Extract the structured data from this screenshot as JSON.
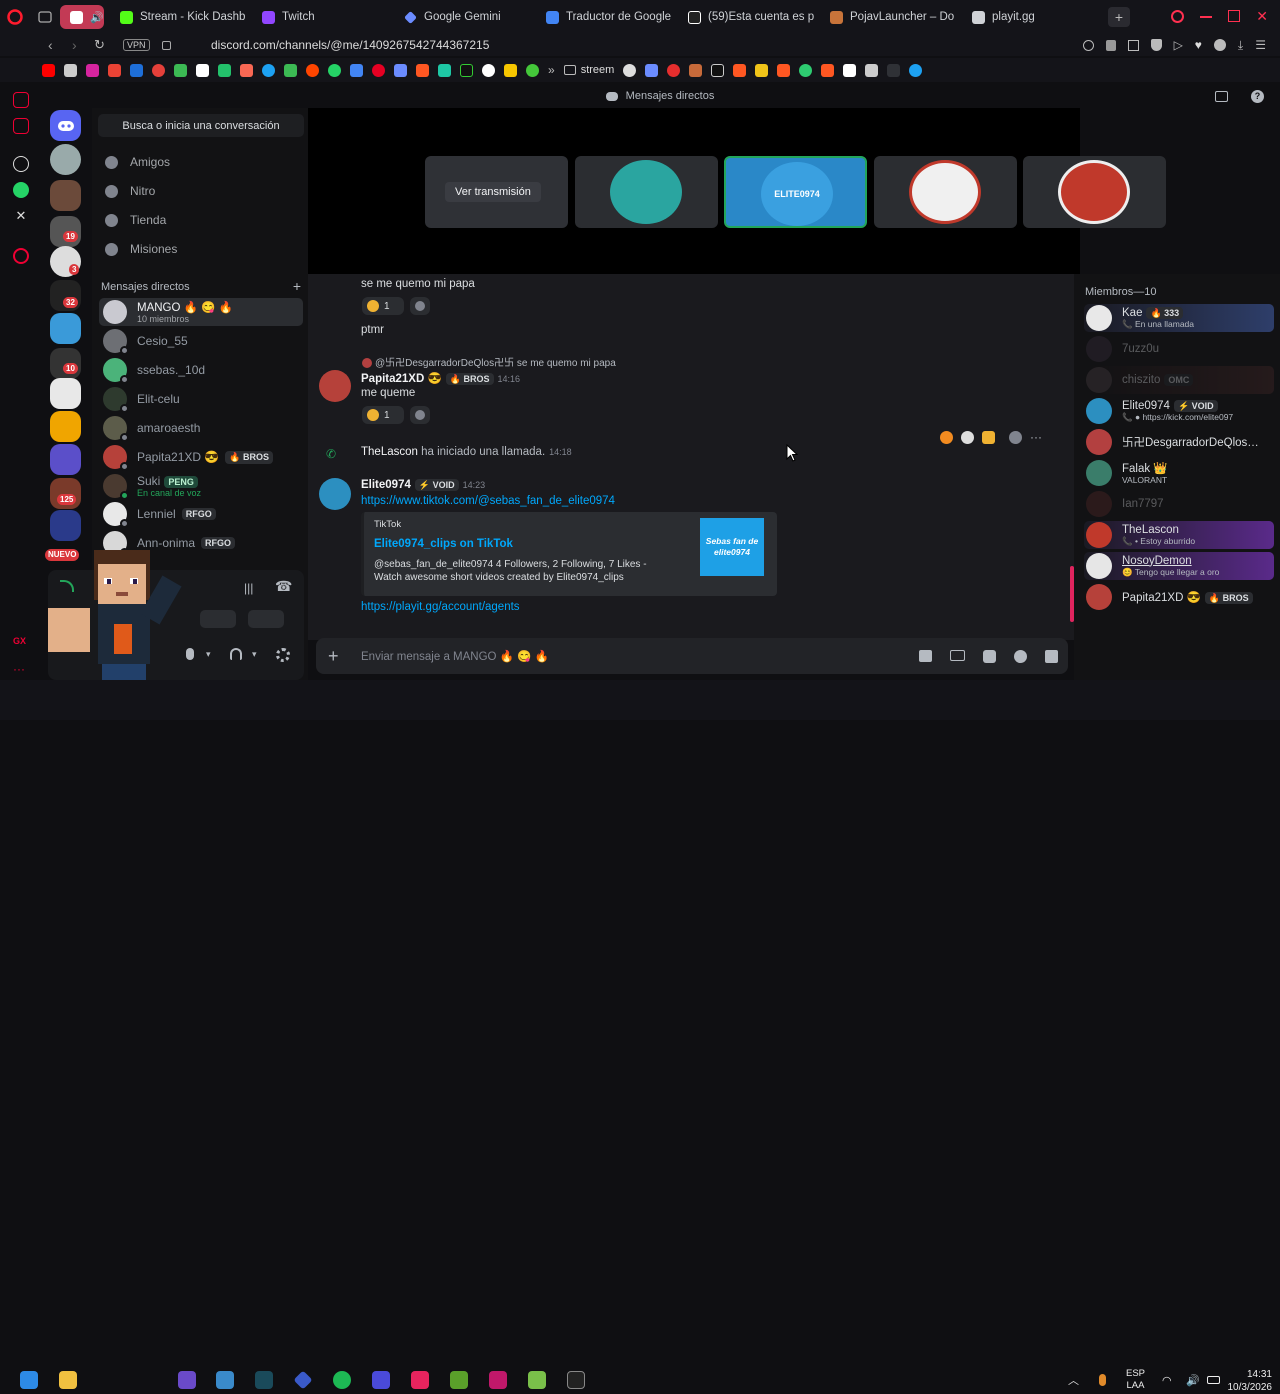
{
  "browser": {
    "tabs": [
      {
        "label": "",
        "icon": "youtube-music-icon",
        "color": "#e74c6b"
      },
      {
        "label": "Stream - Kick Dashb",
        "icon": "kick-icon",
        "color": "#53fc18"
      },
      {
        "label": "Twitch",
        "icon": "twitch-icon",
        "color": "#9146ff"
      },
      {
        "label": "Google Gemini",
        "icon": "gemini-icon",
        "color": "#6b8cff"
      },
      {
        "label": "Traductor de Google",
        "icon": "translate-icon",
        "color": "#4285f4"
      },
      {
        "label": "(59)Esta cuenta es p",
        "icon": "tiktok-icon",
        "color": "#ffffff"
      },
      {
        "label": "PojavLauncher – Do",
        "icon": "box-icon",
        "color": "#c8743a"
      },
      {
        "label": "playit.gg",
        "icon": "playit-icon",
        "color": "#cfd2d6"
      }
    ],
    "vpn": "VPN",
    "url": "discord.com/channels/@me/1409267542744367215",
    "bookmark_folder": "streem"
  },
  "discord": {
    "top_title": "Mensajes directos",
    "search_placeholder": "Busca o inicia una conversación",
    "nav": [
      {
        "label": "Amigos"
      },
      {
        "label": "Nitro"
      },
      {
        "label": "Tienda"
      },
      {
        "label": "Misiones"
      }
    ],
    "dm_header": "Mensajes directos",
    "dm_add": "+",
    "dms": [
      {
        "name": "MANGO 🔥 😋 🔥",
        "sub": "10 miembros",
        "color": "#c9c9d0",
        "selected": true
      },
      {
        "name": "Cesio_55",
        "sub": "",
        "color": "#6d6f74"
      },
      {
        "name": "ssebas._10d",
        "sub": "",
        "color": "#4bb37a"
      },
      {
        "name": "Elit-celu",
        "sub": "",
        "color": "#2e3a2e"
      },
      {
        "name": "amaroaesth",
        "sub": "",
        "color": "#5c5c4a"
      },
      {
        "name": "Papita21XD 😎",
        "tag": "🔥 BROS",
        "sub": "",
        "color": "#b6413a"
      },
      {
        "name": "Suki",
        "tag": "PENG",
        "sub": "En canal de voz",
        "color": "#4a3a30"
      },
      {
        "name": "Lenniel",
        "tag": "RFGO",
        "sub": "",
        "color": "#e8e8e8"
      },
      {
        "name": "Ann-onima",
        "tag": "RFGO",
        "sub": "",
        "color": "#d8d8d8"
      }
    ],
    "server_badges": [
      "19",
      "3",
      "32",
      "10",
      "125"
    ],
    "new_badge": "NUEVO",
    "stream_button": "Ver transmisión",
    "tile_logo_text": "ELITE0974",
    "messages": {
      "m1": "se me quemo mi papa",
      "react1_count": "1",
      "m2": "ptmr",
      "reply_ref": "@卐卍DesgarradorDeQlos卍卐 se me quemo mi papa",
      "author1": "Papita21XD 😎",
      "author1_tag": "🔥 BROS",
      "author1_time": "14:16",
      "m3": "me queme",
      "react2_count": "1",
      "call_user": "TheLascon",
      "call_text": "ha iniciado una llamada.",
      "call_time": "14:18",
      "author2": "Elite0974",
      "author2_tag": "⚡ VOID",
      "author2_time": "14:23",
      "link1": "https://www.tiktok.com/@sebas_fan_de_elite0974",
      "embed_provider": "TikTok",
      "embed_title": "Elite0974_clips on TikTok",
      "embed_desc1": "@sebas_fan_de_elite0974 4 Followers, 2 Following, 7 Likes -",
      "embed_desc2": "Watch awesome short videos created by Elite0974_clips",
      "embed_thumb": "Sebas fan de elite0974",
      "link2": "https://playit.gg/account/agents"
    },
    "composer_placeholder": "Enviar mensaje a MANGO 🔥 😋 🔥",
    "members_header": "Miembros—10",
    "members": [
      {
        "name": "Kae",
        "tag": "🔥 333",
        "status": "📞 En una llamada",
        "color": "#e8e8e8",
        "active": true
      },
      {
        "name": "7uzz0u",
        "status": "",
        "color": "#3a3140",
        "offline": true
      },
      {
        "name": "chiszito",
        "tag": "OMC",
        "status": "",
        "color": "#4b4246",
        "offline": true
      },
      {
        "name": "Elite0974",
        "tag": "⚡ VOID",
        "status": "📞 ● https://kick.com/elite097",
        "color": "#2c8fc0"
      },
      {
        "name": "卐卍DesgarradorDeQlos…",
        "status": "",
        "color": "#b34040"
      },
      {
        "name": "Falak 👑",
        "status": "VALORANT",
        "color": "#3a7d6a"
      },
      {
        "name": "Ian7797",
        "status": "",
        "color": "#5a2a2a",
        "offline": true
      },
      {
        "name": "TheLascon",
        "status": "📞 • Estoy aburrido",
        "color": "#c0392b",
        "active": true
      },
      {
        "name": "NosoyDemon",
        "status": "😊 Tengo que llegar a oro",
        "color": "#e6e6e6",
        "active": true
      },
      {
        "name": "Papita21XD 😎",
        "tag": "🔥 BROS",
        "status": "",
        "color": "#b6413a"
      }
    ]
  },
  "taskbar": {
    "lang1": "ESP",
    "lang2": "LAA",
    "time": "14:31",
    "date": "10/3/2026"
  }
}
